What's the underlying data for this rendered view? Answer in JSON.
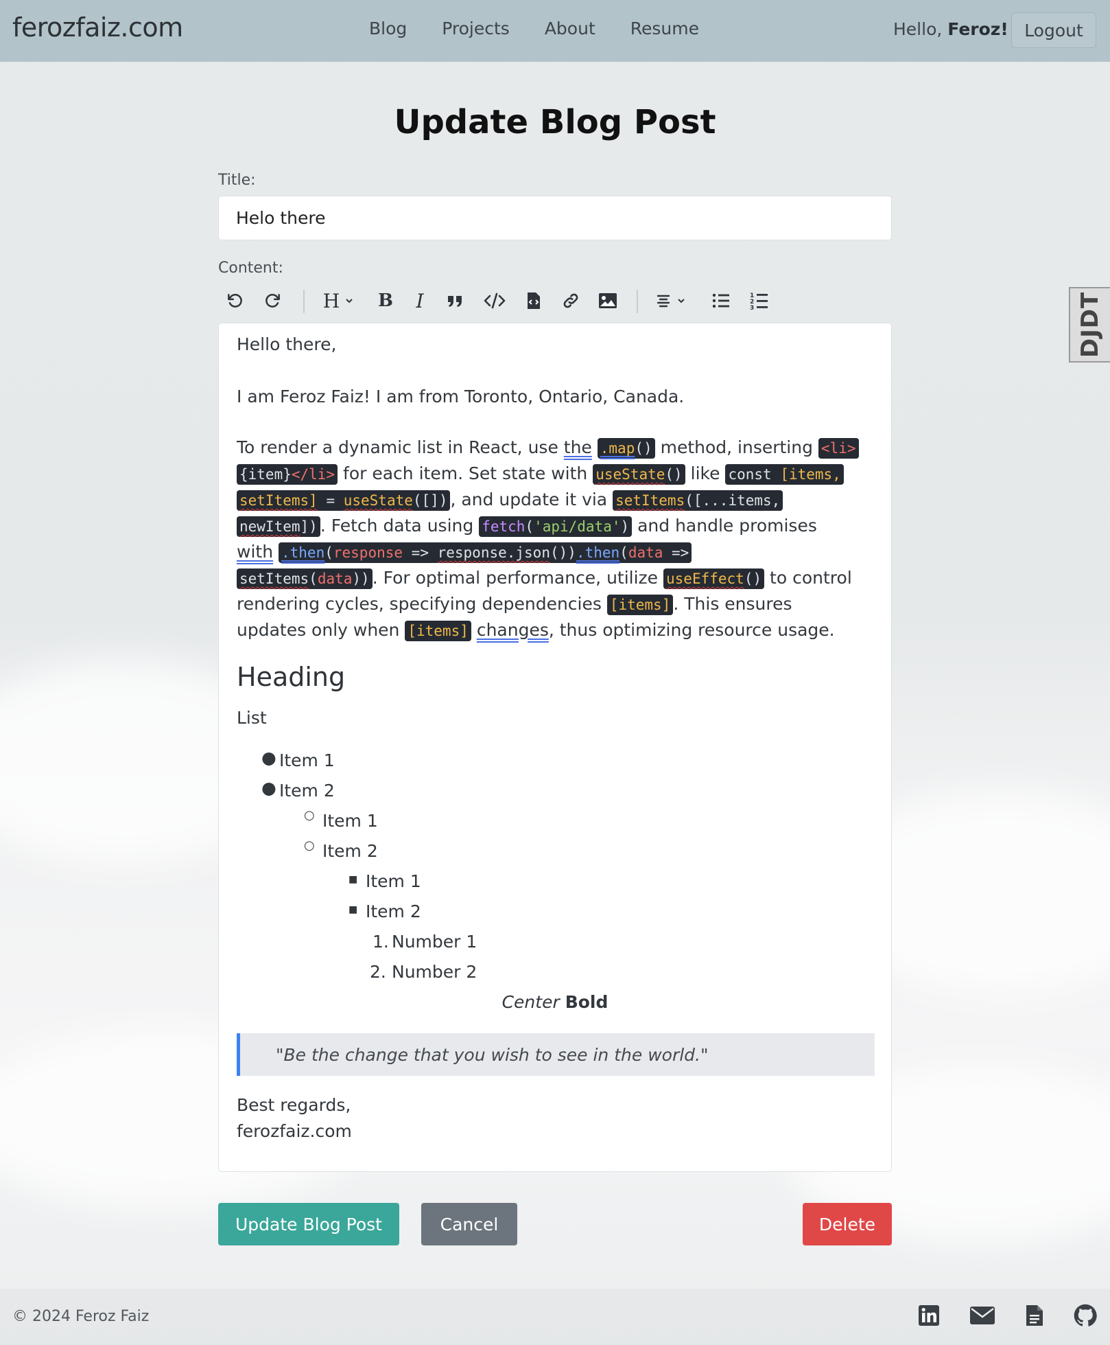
{
  "header": {
    "brand": "ferozfaiz.com",
    "nav": [
      "Blog",
      "Projects",
      "About",
      "Resume"
    ],
    "greeting": "Hello,",
    "username": "Feroz!",
    "logout_label": "Logout"
  },
  "page_title": "Update Blog Post",
  "form": {
    "title_label": "Title:",
    "title_value": "Helo there",
    "content_label": "Content:"
  },
  "toolbar": {
    "icons": [
      "undo-icon",
      "redo-icon",
      "heading-icon",
      "bold-icon",
      "italic-icon",
      "quote-icon",
      "code-icon",
      "code-block-icon",
      "link-icon",
      "image-icon",
      "align-icon",
      "bullet-list-icon",
      "ordered-list-icon"
    ],
    "heading_letter": "H",
    "bold_letter": "B",
    "italic_letter": "I"
  },
  "editor": {
    "greeting": "Hello there,",
    "intro": "I am Feroz Faiz! I am from Toronto, Ontario, Canada.",
    "paragraph": {
      "l1_a": "To render a dynamic list in React, use ",
      "l1_the": "the",
      "l1_code1": ".map",
      "l1_code1b": "()",
      "l1_b": " method, inserting ",
      "l1_code2": "<li>",
      "l2_code": "{item}",
      "l2_codeb": "</li>",
      "l2_a": " for each item. Set state with ",
      "l2_code2": "useState",
      "l2_code2b": "()",
      "l2_b": " like ",
      "l2_code3": "const ",
      "l2_code3b": "[items,",
      "l3_code": "setItems]",
      "l3_codeb": " = ",
      "l3_codec": "useState",
      "l3_coded": "([])",
      "l3_a": ", and update it via ",
      "l3_code2": "setItems",
      "l3_code2b": "([...items,",
      "l4_code": "newItem",
      "l4_codeb": "])",
      "l4_a": ". Fetch data using ",
      "l4_code2": "fetch",
      "l4_code2b": "(",
      "l4_code2c": "'api/data'",
      "l4_code2d": ")",
      "l4_b": " and handle promises",
      "l5_with": "with",
      "l5_code": ".then",
      "l5_codeb": "(",
      "l5_codec": "response",
      "l5_coded": " => ",
      "l5_codee": "response.json",
      "l5_codef": "()",
      "l5_codeg": ")",
      "l5_codeh": ".then",
      "l5_codei": "(",
      "l5_codej": "data",
      "l5_codek": " =>",
      "l6_code": "setItems",
      "l6_codeb": "(",
      "l6_codec": "data",
      "l6_coded": "))",
      "l6_a": ". For optimal performance, utilize ",
      "l6_code2": "useEffect",
      "l6_code2b": "()",
      "l6_b": " to control",
      "l7_a": "rendering cycles, specifying dependencies ",
      "l7_code": "[items]",
      "l7_b": ". This ensures",
      "l8_a": "updates only when ",
      "l8_code": "[items]",
      "l8_changes": "changes",
      "l8_b": ", thus optimizing resource usage."
    },
    "heading": "Heading",
    "list_label": "List",
    "list": {
      "a1": "Item 1",
      "a2": "Item 2",
      "b1": "Item 1",
      "b2": "Item 2",
      "c1": "Item 1",
      "c2": "Item 2",
      "n1_num": "1.",
      "n1": "Number 1",
      "n2_num": "2.",
      "n2": "Number 2"
    },
    "center_italic": "Center",
    "center_bold": "Bold",
    "quote": "\"Be the change that you wish to see in the world.\"",
    "signoff": "Best regards,",
    "signoff_link": "ferozfaiz.com"
  },
  "buttons": {
    "update": "Update Blog Post",
    "cancel": "Cancel",
    "delete": "Delete"
  },
  "colors": {
    "header_bg": "#b2c3c9",
    "update_btn": "#3aa79a",
    "cancel_btn": "#6c757d",
    "delete_btn": "#e04848",
    "quote_border": "#3b82f6",
    "link": "#2f9488"
  },
  "debug_toolbar": "DJDT",
  "footer": {
    "copyright": "© 2024 Feroz Faiz",
    "icons": [
      "linkedin-icon",
      "email-icon",
      "resume-document-icon",
      "github-icon"
    ]
  }
}
